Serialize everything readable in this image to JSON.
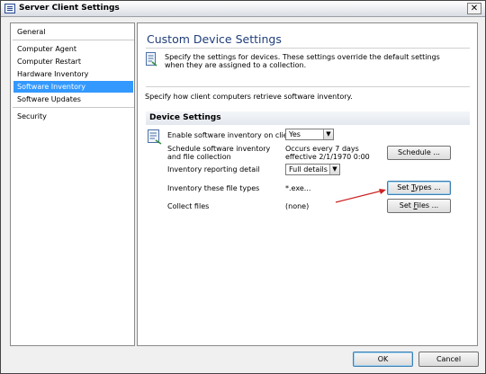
{
  "window": {
    "title": "Server Client Settings",
    "close_glyph": "✕"
  },
  "sidebar": {
    "items": [
      {
        "label": "General"
      },
      {
        "label": "Computer Agent"
      },
      {
        "label": "Computer Restart"
      },
      {
        "label": "Hardware Inventory"
      },
      {
        "label": "Software Inventory"
      },
      {
        "label": "Software Updates"
      },
      {
        "label": "Security"
      }
    ],
    "selected": "Software Inventory"
  },
  "main": {
    "heading": "Custom Device Settings",
    "intro": "Specify the settings for devices. These settings override the default settings when they are assigned to a collection.",
    "retrieve_text": "Specify how client computers retrieve software inventory.",
    "group_title": "Device Settings",
    "rows": {
      "enable": {
        "label": "Enable software inventory on clients",
        "value": "Yes"
      },
      "schedule": {
        "label": "Schedule software inventory and file collection",
        "value": "Occurs every 7 days effective 2/1/1970 0:00",
        "button": "Schedule ..."
      },
      "detail": {
        "label": "Inventory reporting detail",
        "value": "Full details"
      },
      "file_types": {
        "label": "Inventory these file types",
        "value": "*.exe...",
        "button_pre": "Set ",
        "button_u": "T",
        "button_post": "ypes ..."
      },
      "collect": {
        "label": "Collect files",
        "value": "(none)",
        "button_pre": "Set ",
        "button_u": "F",
        "button_post": "iles ..."
      }
    }
  },
  "footer": {
    "ok": "OK",
    "cancel": "Cancel"
  },
  "colors": {
    "selection": "#3399ff",
    "heading": "#1f3d7a",
    "annotation_arrow": "#cc2222"
  }
}
